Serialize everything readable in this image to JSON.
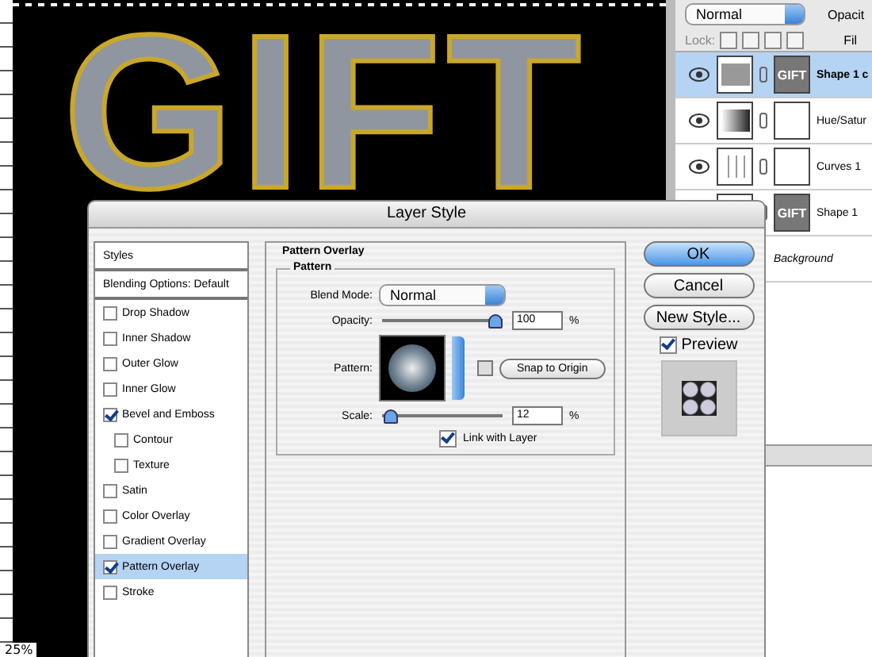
{
  "canvas": {
    "artwork_text": "GIFT",
    "zoom": "25%"
  },
  "layers_panel": {
    "blend_mode": "Normal",
    "opacity_label": "Opacit",
    "lock_label": "Lock:",
    "fill_label": "Fil",
    "layers": [
      {
        "name": "Shape 1 c",
        "kind": "shape",
        "thumb_text": "GIFT",
        "selected": true
      },
      {
        "name": "Hue/Satur",
        "kind": "hue",
        "selected": false
      },
      {
        "name": "Curves 1",
        "kind": "curves",
        "selected": false
      },
      {
        "name": "Shape 1",
        "kind": "shape",
        "thumb_text": "GIFT",
        "selected": false
      },
      {
        "name": "Background",
        "kind": "background",
        "selected": false
      }
    ]
  },
  "dialog": {
    "title": "Layer Style",
    "styles": [
      {
        "label": "Styles",
        "kind": "header",
        "selected": false
      },
      {
        "label": "Blending Options: Default",
        "kind": "header",
        "selected": false
      },
      {
        "label": "Drop Shadow",
        "kind": "check",
        "checked": false,
        "selected": false
      },
      {
        "label": "Inner Shadow",
        "kind": "check",
        "checked": false,
        "selected": false
      },
      {
        "label": "Outer Glow",
        "kind": "check",
        "checked": false,
        "selected": false
      },
      {
        "label": "Inner Glow",
        "kind": "check",
        "checked": false,
        "selected": false
      },
      {
        "label": "Bevel and Emboss",
        "kind": "check",
        "checked": true,
        "selected": false,
        "children": [
          {
            "label": "Contour",
            "kind": "check",
            "checked": false,
            "selected": false
          },
          {
            "label": "Texture",
            "kind": "check",
            "checked": false,
            "selected": false
          }
        ]
      },
      {
        "label": "Satin",
        "kind": "check",
        "checked": false,
        "selected": false
      },
      {
        "label": "Color Overlay",
        "kind": "check",
        "checked": false,
        "selected": false
      },
      {
        "label": "Gradient Overlay",
        "kind": "check",
        "checked": false,
        "selected": false
      },
      {
        "label": "Pattern Overlay",
        "kind": "check",
        "checked": true,
        "selected": true
      },
      {
        "label": "Stroke",
        "kind": "check",
        "checked": false,
        "selected": false
      }
    ],
    "panel": {
      "title": "Pattern Overlay",
      "group": "Pattern",
      "blend_label": "Blend Mode:",
      "blend_value": "Normal",
      "opacity": {
        "label": "Opacity:",
        "level": 1.0,
        "value": "100",
        "unit": "%"
      },
      "pattern_label": "Pattern:",
      "snap_button": "Snap to Origin",
      "scale": {
        "label": "Scale:",
        "level": 0.02,
        "value": "12",
        "unit": "%"
      },
      "link": {
        "label": "Link with Layer",
        "checked": true
      }
    },
    "buttons": [
      {
        "label": "OK",
        "default": true
      },
      {
        "label": "Cancel",
        "default": false
      },
      {
        "label": "New Style...",
        "default": false
      }
    ],
    "preview": {
      "label": "Preview",
      "checked": true
    }
  }
}
